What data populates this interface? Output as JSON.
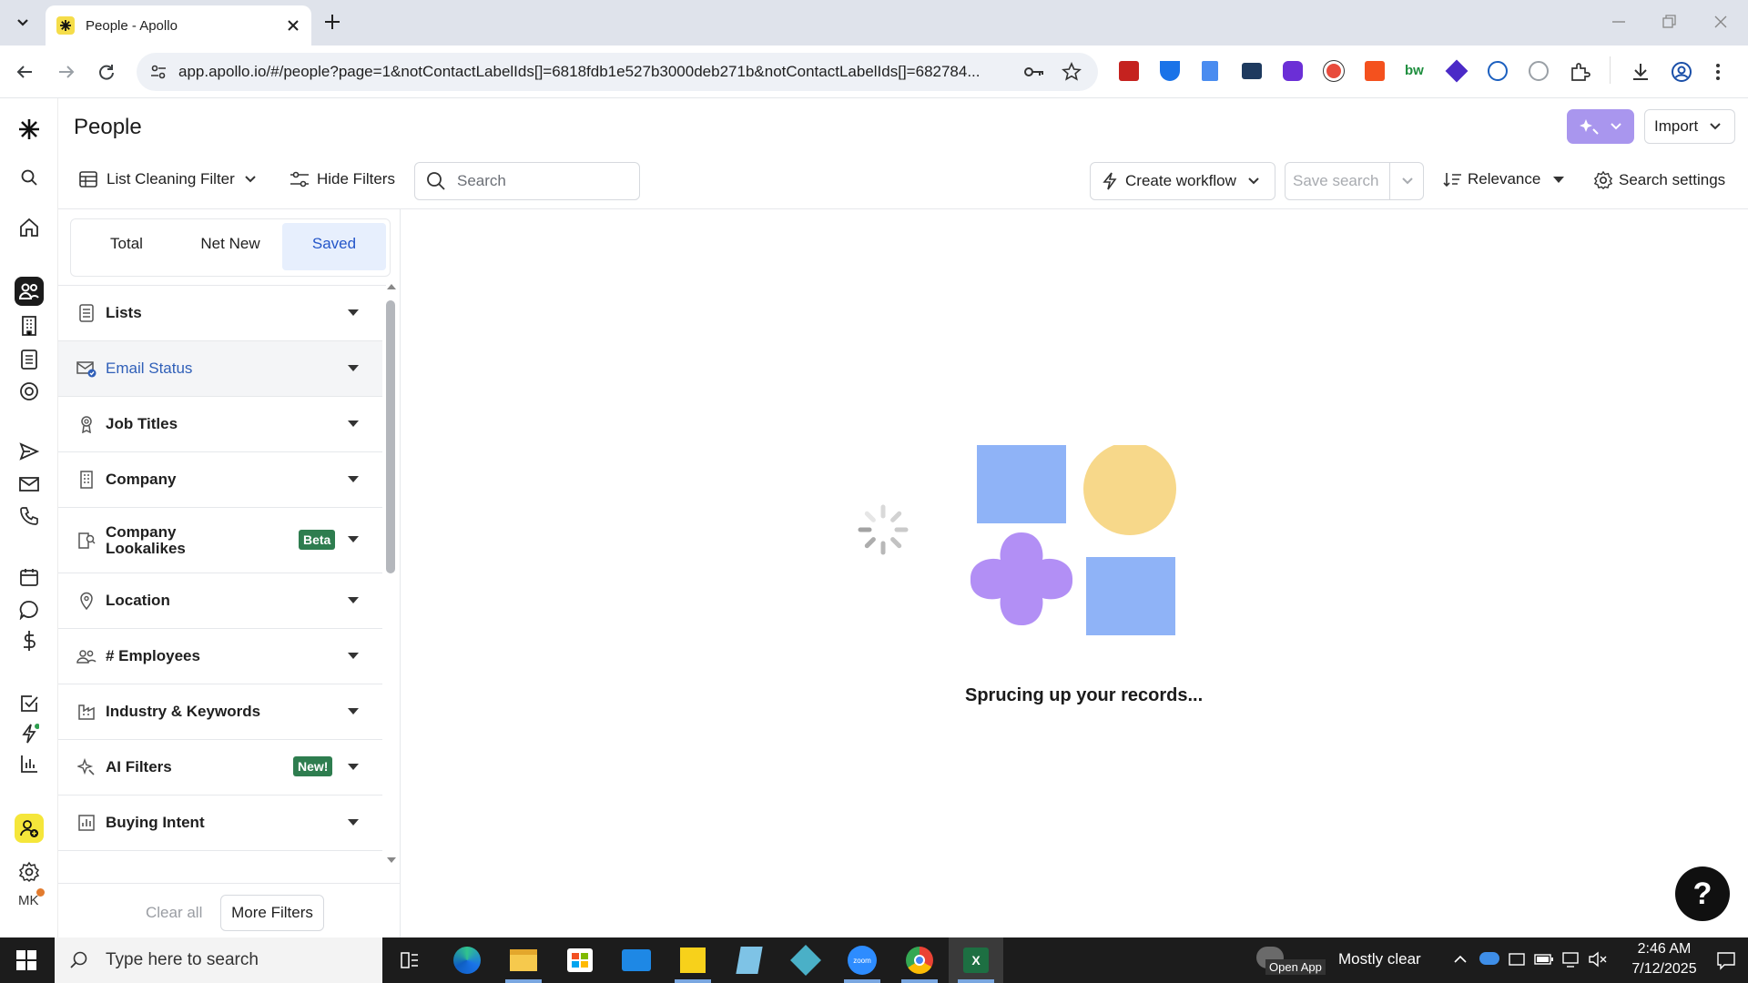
{
  "browser": {
    "tab_title": "People - Apollo",
    "url": "app.apollo.io/#/people?page=1&notContactLabelIds[]=6818fdb1e527b3000deb271b&notContactLabelIds[]=682784..."
  },
  "header": {
    "title": "People",
    "import_label": "Import"
  },
  "toolbar": {
    "list_filter_label": "List Cleaning Filter",
    "hide_filters_label": "Hide Filters",
    "search_placeholder": "Search",
    "create_workflow_label": "Create workflow",
    "save_search_label": "Save search",
    "relevance_label": "Relevance",
    "search_settings_label": "Search settings"
  },
  "filter_tabs": [
    {
      "label": "Total"
    },
    {
      "label": "Net New"
    },
    {
      "label": "Saved"
    }
  ],
  "active_filter_tab": "Saved",
  "filters": [
    {
      "label": "Lists",
      "icon": "list-icon"
    },
    {
      "label": "Email Status",
      "icon": "email-check-icon"
    },
    {
      "label": "Job Titles",
      "icon": "badge-icon"
    },
    {
      "label": "Company",
      "icon": "building-icon"
    },
    {
      "label": "Company Lookalikes",
      "icon": "building-search-icon",
      "badge": "Beta"
    },
    {
      "label": "Location",
      "icon": "location-pin-icon"
    },
    {
      "label": "# Employees",
      "icon": "people-icon"
    },
    {
      "label": "Industry & Keywords",
      "icon": "factory-icon"
    },
    {
      "label": "AI Filters",
      "icon": "sparkle-icon",
      "badge": "New!"
    },
    {
      "label": "Buying Intent",
      "icon": "bar-chart-icon"
    }
  ],
  "filter_footer": {
    "clear_all_label": "Clear all",
    "more_filters_label": "More Filters"
  },
  "loading": {
    "message": "Sprucing up your records..."
  },
  "help": {
    "label": "?"
  },
  "user": {
    "initials": "MK"
  },
  "taskbar": {
    "search_placeholder": "Type here to search",
    "weather": "Mostly clear",
    "open_app": "Open App",
    "time": "2:46 AM",
    "date": "7/12/2025"
  },
  "colors": {
    "accent": "#2456c9",
    "shape_blue": "#8fb3f7",
    "shape_yellow": "#f7d88a",
    "shape_purple": "#b28ff5",
    "ai_button": "#a996ee",
    "beta_badge": "#2e7d4f"
  }
}
